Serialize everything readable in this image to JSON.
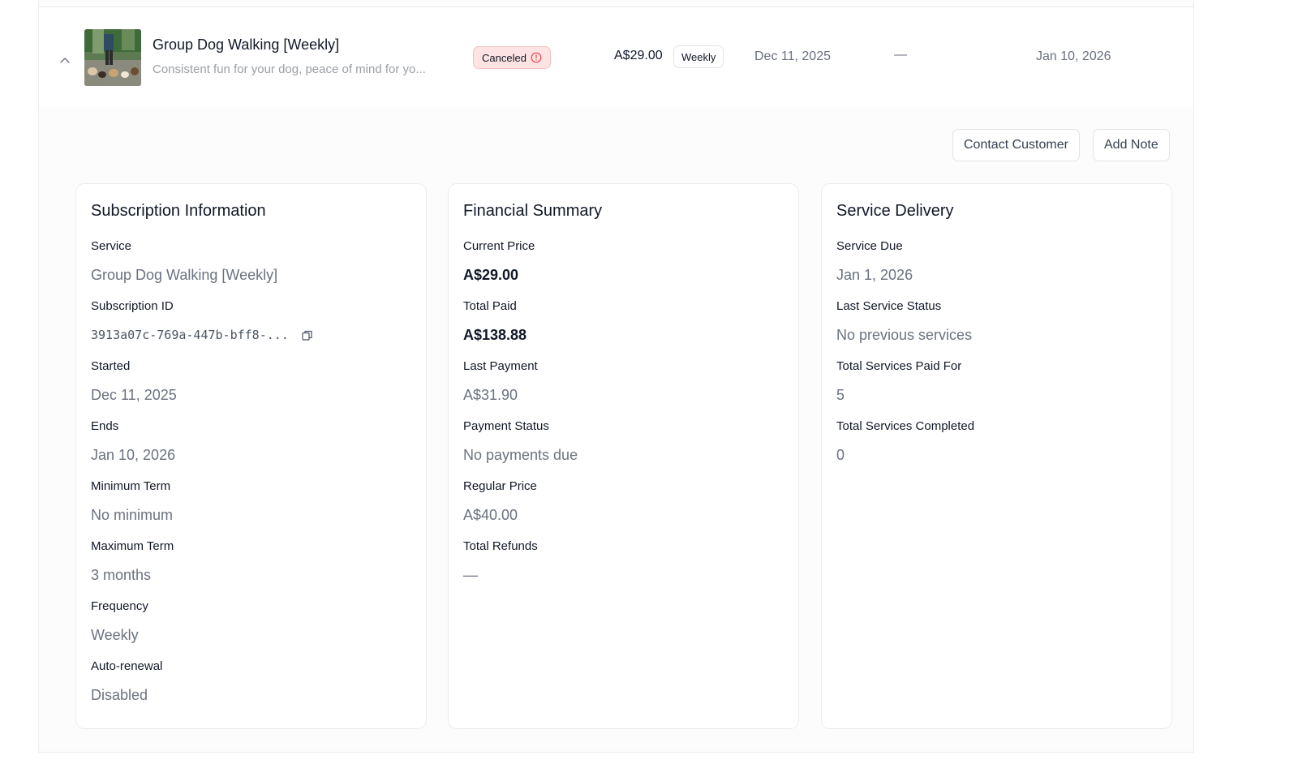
{
  "row": {
    "title": "Group Dog Walking [Weekly]",
    "description": "Consistent fun for your dog, peace of mind for yo...",
    "status": "Canceled",
    "price": "A$29.00",
    "frequency": "Weekly",
    "start_date": "Dec 11, 2025",
    "middle": "—",
    "end_date": "Jan 10, 2026"
  },
  "actions": {
    "contact": "Contact Customer",
    "note": "Add Note"
  },
  "subscription": {
    "heading": "Subscription Information",
    "fields": [
      {
        "label": "Service",
        "value": "Group Dog Walking [Weekly]"
      },
      {
        "label": "Subscription ID",
        "value": "3913a07c-769a-447b-bff8-..."
      },
      {
        "label": "Started",
        "value": "Dec 11, 2025"
      },
      {
        "label": "Ends",
        "value": "Jan 10, 2026"
      },
      {
        "label": "Minimum Term",
        "value": "No minimum"
      },
      {
        "label": "Maximum Term",
        "value": "3 months"
      },
      {
        "label": "Frequency",
        "value": "Weekly"
      },
      {
        "label": "Auto-renewal",
        "value": "Disabled"
      }
    ]
  },
  "financial": {
    "heading": "Financial Summary",
    "fields": [
      {
        "label": "Current Price",
        "value": "A$29.00"
      },
      {
        "label": "Total Paid",
        "value": "A$138.88"
      },
      {
        "label": "Last Payment",
        "value": "A$31.90"
      },
      {
        "label": "Payment Status",
        "value": "No payments due"
      },
      {
        "label": "Regular Price",
        "value": "A$40.00"
      },
      {
        "label": "Total Refunds",
        "value": "—"
      }
    ]
  },
  "delivery": {
    "heading": "Service Delivery",
    "fields": [
      {
        "label": "Service Due",
        "value": "Jan 1, 2026"
      },
      {
        "label": "Last Service Status",
        "value": "No previous services"
      },
      {
        "label": "Total Services Paid For",
        "value": "5"
      },
      {
        "label": "Total Services Completed",
        "value": "0"
      }
    ]
  },
  "colors": {
    "canceled_bg": "#fde3e3",
    "canceled_icon": "#e5484d",
    "muted_text": "#6b7280"
  },
  "icons": {
    "collapse": "chevron-up-icon",
    "status": "info-circle-icon",
    "copy": "copy-icon"
  }
}
